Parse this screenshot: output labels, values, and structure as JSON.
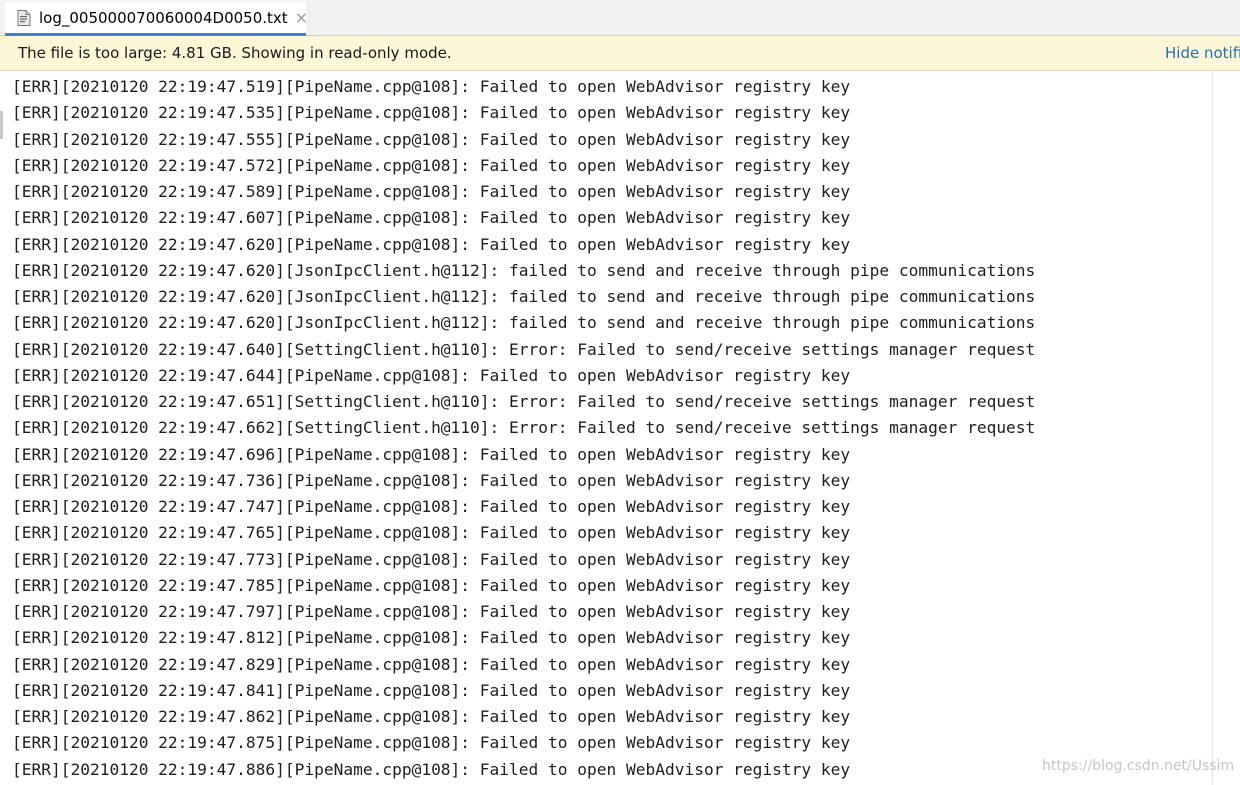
{
  "tab": {
    "title": "log_005000070060004D0050.txt",
    "icon": "text-file-icon",
    "close_glyph": "×"
  },
  "banner": {
    "message": "The file is too large: 4.81 GB. Showing in read-only mode.",
    "action_label": "Hide notifi"
  },
  "log_lines": [
    "[ERR][20210120 22:19:47.519][PipeName.cpp@108]: Failed to open WebAdvisor registry key",
    "[ERR][20210120 22:19:47.535][PipeName.cpp@108]: Failed to open WebAdvisor registry key",
    "[ERR][20210120 22:19:47.555][PipeName.cpp@108]: Failed to open WebAdvisor registry key",
    "[ERR][20210120 22:19:47.572][PipeName.cpp@108]: Failed to open WebAdvisor registry key",
    "[ERR][20210120 22:19:47.589][PipeName.cpp@108]: Failed to open WebAdvisor registry key",
    "[ERR][20210120 22:19:47.607][PipeName.cpp@108]: Failed to open WebAdvisor registry key",
    "[ERR][20210120 22:19:47.620][PipeName.cpp@108]: Failed to open WebAdvisor registry key",
    "[ERR][20210120 22:19:47.620][JsonIpcClient.h@112]: failed to send and receive through pipe communications",
    "[ERR][20210120 22:19:47.620][JsonIpcClient.h@112]: failed to send and receive through pipe communications",
    "[ERR][20210120 22:19:47.620][JsonIpcClient.h@112]: failed to send and receive through pipe communications",
    "[ERR][20210120 22:19:47.640][SettingClient.h@110]: Error: Failed to send/receive settings manager request",
    "[ERR][20210120 22:19:47.644][PipeName.cpp@108]: Failed to open WebAdvisor registry key",
    "[ERR][20210120 22:19:47.651][SettingClient.h@110]: Error: Failed to send/receive settings manager request",
    "[ERR][20210120 22:19:47.662][SettingClient.h@110]: Error: Failed to send/receive settings manager request",
    "[ERR][20210120 22:19:47.696][PipeName.cpp@108]: Failed to open WebAdvisor registry key",
    "[ERR][20210120 22:19:47.736][PipeName.cpp@108]: Failed to open WebAdvisor registry key",
    "[ERR][20210120 22:19:47.747][PipeName.cpp@108]: Failed to open WebAdvisor registry key",
    "[ERR][20210120 22:19:47.765][PipeName.cpp@108]: Failed to open WebAdvisor registry key",
    "[ERR][20210120 22:19:47.773][PipeName.cpp@108]: Failed to open WebAdvisor registry key",
    "[ERR][20210120 22:19:47.785][PipeName.cpp@108]: Failed to open WebAdvisor registry key",
    "[ERR][20210120 22:19:47.797][PipeName.cpp@108]: Failed to open WebAdvisor registry key",
    "[ERR][20210120 22:19:47.812][PipeName.cpp@108]: Failed to open WebAdvisor registry key",
    "[ERR][20210120 22:19:47.829][PipeName.cpp@108]: Failed to open WebAdvisor registry key",
    "[ERR][20210120 22:19:47.841][PipeName.cpp@108]: Failed to open WebAdvisor registry key",
    "[ERR][20210120 22:19:47.862][PipeName.cpp@108]: Failed to open WebAdvisor registry key",
    "[ERR][20210120 22:19:47.875][PipeName.cpp@108]: Failed to open WebAdvisor registry key",
    "[ERR][20210120 22:19:47.886][PipeName.cpp@108]: Failed to open WebAdvisor registry key"
  ],
  "watermark": "https://blog.csdn.net/Ussim",
  "colors": {
    "tab_underline": "#4083c9",
    "banner_background": "#fdf6d7",
    "banner_link": "#2470b3",
    "text": "#1e1e1e"
  }
}
